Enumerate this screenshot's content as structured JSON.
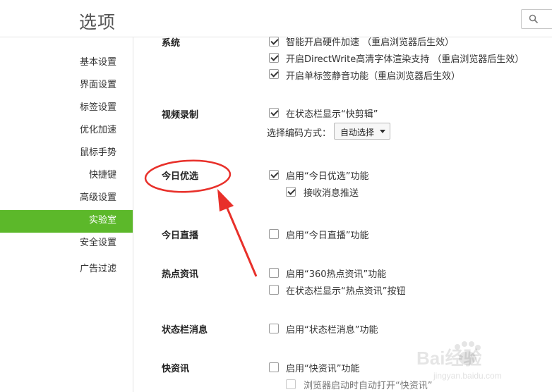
{
  "header": {
    "title": "选项",
    "search_icon": "search-icon"
  },
  "sidebar": {
    "items": [
      {
        "label": "基本设置"
      },
      {
        "label": "界面设置"
      },
      {
        "label": "标签设置"
      },
      {
        "label": "优化加速"
      },
      {
        "label": "鼠标手势"
      },
      {
        "label": "快捷键"
      },
      {
        "label": "高级设置"
      },
      {
        "label": "实验室",
        "active": true
      },
      {
        "label": "安全设置"
      },
      {
        "label": "广告过滤"
      }
    ]
  },
  "main": {
    "system": {
      "title": "系统",
      "options": [
        {
          "label": "智能开启硬件加速 （重启浏览器后生效）",
          "checked": true
        },
        {
          "label": "开启DirectWrite高清字体渲染支持 （重启浏览器后生效）",
          "checked": true
        },
        {
          "label": "开启单标签静音功能（重启浏览器后生效）",
          "checked": true
        }
      ]
    },
    "video": {
      "title": "视频录制",
      "option": {
        "label": "在状态栏显示“快剪辑”",
        "checked": true
      },
      "encoding_label": "选择编码方式：",
      "encoding_value": "自动选择"
    },
    "today_pick": {
      "title": "今日优选",
      "options": [
        {
          "label": "启用“今日优选”功能",
          "checked": true
        },
        {
          "label": "接收消息推送",
          "checked": true
        }
      ]
    },
    "today_live": {
      "title": "今日直播",
      "option": {
        "label": "启用“今日直播”功能",
        "checked": false
      }
    },
    "hot_news": {
      "title": "热点资讯",
      "options": [
        {
          "label": "启用“360热点资讯”功能",
          "checked": false
        },
        {
          "label": "在状态栏显示“热点资讯”按钮",
          "checked": false
        }
      ]
    },
    "status_msg": {
      "title": "状态栏消息",
      "option": {
        "label": "启用“状态栏消息”功能",
        "checked": false
      }
    },
    "quick_news": {
      "title": "快资讯",
      "options": [
        {
          "label": "启用“快资讯”功能",
          "checked": false
        },
        {
          "label": "浏览器启动时自动打开“快资讯”",
          "checked": false,
          "disabled": true
        }
      ]
    }
  },
  "annotation": {
    "color": "#e8302a"
  },
  "watermark": {
    "text": "Bai经验",
    "url": "jingyan.baidu.com"
  },
  "colors": {
    "accent": "#5cb82a"
  }
}
